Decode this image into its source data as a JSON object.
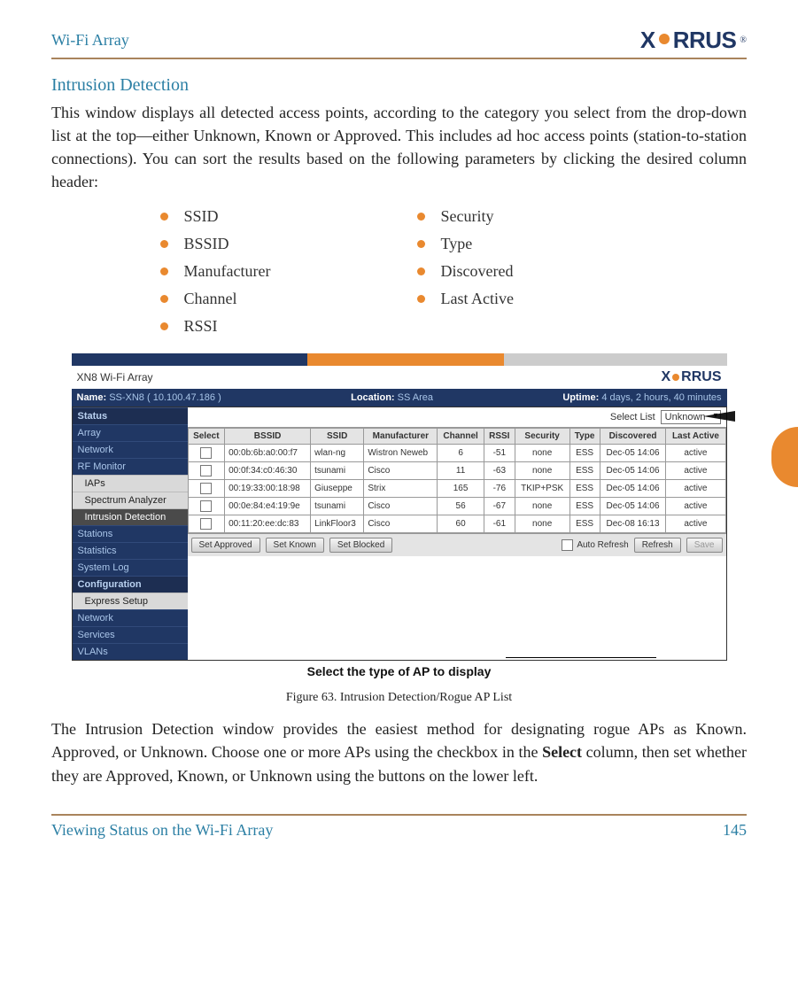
{
  "header": {
    "doc_title": "Wi-Fi Array",
    "brand_prefix": "X",
    "brand_suffix": "RRUS"
  },
  "section_heading": "Intrusion Detection",
  "intro_para": "This window displays all detected access points, according to the category you select from the drop-down list at the top—either Unknown, Known or Approved. This includes ad hoc access points (station-to-station connections). You can sort the results based on the following parameters by clicking the desired column header:",
  "bullets_col1": [
    "SSID",
    "BSSID",
    "Manufacturer",
    "Channel",
    "RSSI"
  ],
  "bullets_col2": [
    "Security",
    "Type",
    "Discovered",
    "Last Active"
  ],
  "figure": {
    "product_top_label": "XN8 Wi-Fi Array",
    "status": {
      "name_label": "Name:",
      "name_value": "SS-XN8   ( 10.100.47.186 )",
      "loc_label": "Location:",
      "loc_value": "SS Area",
      "uptime_label": "Uptime:",
      "uptime_value": "4 days, 2 hours, 40 minutes"
    },
    "nav": {
      "status_label": "Status",
      "items_status": [
        "Array",
        "Network",
        "RF Monitor"
      ],
      "rf_sub": [
        "IAPs",
        "Spectrum Analyzer",
        "Intrusion Detection"
      ],
      "items_status2": [
        "Stations",
        "Statistics",
        "System Log"
      ],
      "config_label": "Configuration",
      "items_config": [
        "Express Setup",
        "Network",
        "Services",
        "VLANs"
      ]
    },
    "select_list_label": "Select List",
    "select_list_value": "Unknown",
    "columns": [
      "Select",
      "BSSID",
      "SSID",
      "Manufacturer",
      "Channel",
      "RSSI",
      "Security",
      "Type",
      "Discovered",
      "Last Active"
    ],
    "rows": [
      {
        "bssid": "00:0b:6b:a0:00:f7",
        "ssid": "wlan-ng",
        "mfr": "Wistron Neweb",
        "ch": "6",
        "rssi": "-51",
        "sec": "none",
        "type": "ESS",
        "disc": "Dec-05 14:06",
        "last": "active"
      },
      {
        "bssid": "00:0f:34:c0:46:30",
        "ssid": "tsunami",
        "mfr": "Cisco",
        "ch": "11",
        "rssi": "-63",
        "sec": "none",
        "type": "ESS",
        "disc": "Dec-05 14:06",
        "last": "active"
      },
      {
        "bssid": "00:19:33:00:18:98",
        "ssid": "Giuseppe",
        "mfr": "Strix",
        "ch": "165",
        "rssi": "-76",
        "sec": "TKIP+PSK",
        "type": "ESS",
        "disc": "Dec-05 14:06",
        "last": "active"
      },
      {
        "bssid": "00:0e:84:e4:19:9e",
        "ssid": "tsunami",
        "mfr": "Cisco",
        "ch": "56",
        "rssi": "-67",
        "sec": "none",
        "type": "ESS",
        "disc": "Dec-05 14:06",
        "last": "active"
      },
      {
        "bssid": "00:11:20:ee:dc:83",
        "ssid": "LinkFloor3",
        "mfr": "Cisco",
        "ch": "60",
        "rssi": "-61",
        "sec": "none",
        "type": "ESS",
        "disc": "Dec-08 16:13",
        "last": "active"
      }
    ],
    "buttons": {
      "approved": "Set Approved",
      "known": "Set Known",
      "blocked": "Set Blocked",
      "refresh": "Refresh",
      "save": "Save",
      "auto": "Auto Refresh"
    },
    "callout": "Select the type of AP to display",
    "caption": "Figure 63. Intrusion Detection/Rogue AP List"
  },
  "outro_para_prefix": "The Intrusion Detection window provides the easiest method for designating rogue APs as Known. Approved, or Unknown. Choose one or more APs using the checkbox in the ",
  "outro_para_bold": "Select",
  "outro_para_suffix": " column, then set whether they are Approved, Known, or Unknown using the buttons on the lower left.",
  "footer": {
    "text": "Viewing Status on the Wi-Fi Array",
    "page": "145"
  }
}
